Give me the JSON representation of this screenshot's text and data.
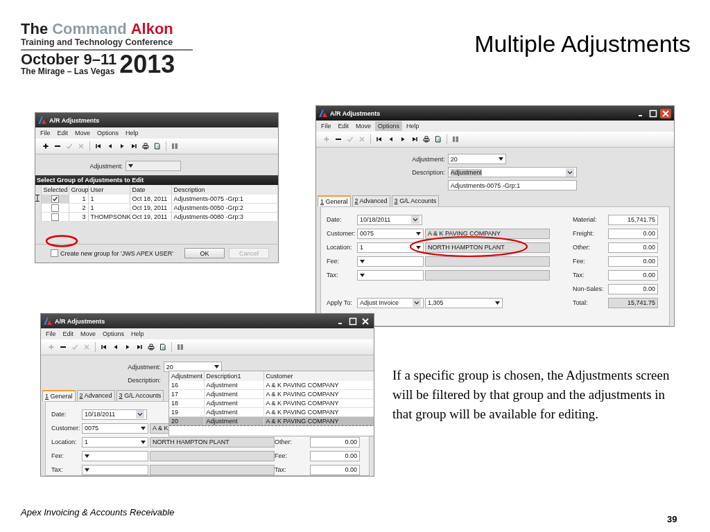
{
  "logo": {
    "words": [
      {
        "text": "The",
        "color": "#231f20"
      },
      {
        "text": "Command",
        "color": "#8d9ca6"
      },
      {
        "text": "Alkon",
        "color": "#c8102e"
      }
    ],
    "tagline": "Training and Technology Conference",
    "dates": "October 9–11",
    "venue": "The Mirage – Las Vegas",
    "year": "2013"
  },
  "title": "Multiple Adjustments",
  "windows": [
    {
      "kind": "group_picker",
      "title": "A/R Adjustments",
      "window_buttons": false,
      "menu": [
        {
          "label": "File",
          "selected": false
        },
        {
          "label": "Edit",
          "selected": false
        },
        {
          "label": "Move",
          "selected": false
        },
        {
          "label": "Options",
          "selected": false
        },
        {
          "label": "Help",
          "selected": false
        }
      ],
      "toolbar": [
        {
          "kind": "add",
          "disabled": false
        },
        {
          "kind": "remove",
          "disabled": false
        },
        {
          "kind": "confirm",
          "disabled": true
        },
        {
          "kind": "cancel",
          "disabled": true
        },
        {
          "kind": "first",
          "disabled": false
        },
        {
          "kind": "previous",
          "disabled": false
        },
        {
          "kind": "next",
          "disabled": false
        },
        {
          "kind": "last",
          "disabled": false
        },
        {
          "kind": "print",
          "disabled": false
        },
        {
          "kind": "preview",
          "disabled": false
        },
        {
          "kind": "columns",
          "disabled": false
        }
      ],
      "adjustment": {
        "label": "Adjustment:"
      },
      "section_title": "Select Group of Adjustments to Edit",
      "table": {
        "columns": [
          "Selected",
          "Group",
          "User",
          "Date",
          "Description"
        ],
        "rows": [
          {
            "current": true,
            "checked": true,
            "group": "1",
            "user": "1",
            "date": "Oct 18, 2011",
            "description": "Adjustments-0075 -Grp:1"
          },
          {
            "current": false,
            "checked": false,
            "group": "2",
            "user": "1",
            "date": "Oct 19, 2011",
            "description": "Adjustments-0050 -Grp:2"
          },
          {
            "current": false,
            "checked": false,
            "group": "3",
            "user": "THOMPSONK",
            "date": "Oct 19, 2011",
            "description": "Adjustments-0080 -Grp:3"
          }
        ]
      },
      "new_group": {
        "label": "Create new group for 'JWS APEX USER'",
        "checked": false
      },
      "buttons": [
        {
          "label": "OK",
          "disabled": false
        },
        {
          "label": "Cancel",
          "disabled": true
        }
      ]
    },
    {
      "kind": "editor",
      "title": "A/R Adjustments",
      "window_buttons": true,
      "active": true,
      "menu": [
        {
          "label": "File",
          "selected": false
        },
        {
          "label": "Edit",
          "selected": false
        },
        {
          "label": "Move",
          "selected": false
        },
        {
          "label": "Options",
          "selected": true
        },
        {
          "label": "Help",
          "selected": false
        }
      ],
      "toolbar": [
        {
          "kind": "add",
          "disabled": true
        },
        {
          "kind": "remove",
          "disabled": false
        },
        {
          "kind": "confirm",
          "disabled": true
        },
        {
          "kind": "cancel",
          "disabled": true
        },
        {
          "kind": "first",
          "disabled": false
        },
        {
          "kind": "previous",
          "disabled": false
        },
        {
          "kind": "next",
          "disabled": false
        },
        {
          "kind": "last",
          "disabled": false
        },
        {
          "kind": "print",
          "disabled": false
        },
        {
          "kind": "preview",
          "disabled": false
        },
        {
          "kind": "columns",
          "disabled": false
        }
      ],
      "adjustment": {
        "label": "Adjustment:",
        "value": "20"
      },
      "description": {
        "label": "Description:",
        "value": "Adjustment",
        "note": "Adjustments-0075 -Grp:1"
      },
      "tabs": [
        {
          "label": "1 General",
          "selected": true
        },
        {
          "label": "2 Advanced",
          "selected": false
        },
        {
          "label": "3 G/L Accounts",
          "selected": false
        }
      ],
      "rows": [
        {
          "left": {
            "kind": "date",
            "label": "Date:",
            "value": "10/18/2011"
          },
          "right": {
            "label": "Material:",
            "value": "15,741.75",
            "readonly": false
          }
        },
        {
          "left": {
            "kind": "lookup",
            "label": "Customer:",
            "value": "0075",
            "name": "A & K PAVING COMPANY"
          },
          "right": {
            "label": "Freight:",
            "value": "0.00",
            "readonly": false
          }
        },
        {
          "left": {
            "kind": "lookup",
            "label": "Location:",
            "value": "1",
            "name": "NORTH HAMPTON PLANT"
          },
          "right": {
            "label": "Other:",
            "value": "0.00",
            "readonly": false
          }
        },
        {
          "left": {
            "kind": "lookup",
            "label": "Fee:"
          },
          "right": {
            "label": "Fee:",
            "value": "0.00",
            "readonly": false
          }
        },
        {
          "left": {
            "kind": "lookup",
            "label": "Tax:"
          },
          "right": {
            "label": "Tax:",
            "value": "0.00",
            "readonly": false
          }
        },
        {
          "right": {
            "label": "Non-Sales:",
            "value": "0.00",
            "readonly": false
          }
        },
        {
          "left": {
            "kind": "apply",
            "label": "Apply To:",
            "value": "Adjust Invoice",
            "reference": "1,305"
          },
          "right": {
            "label": "Total:",
            "value": "15,741.75",
            "readonly": true
          }
        }
      ]
    },
    {
      "kind": "editor",
      "title": "A/R Adjustments",
      "window_buttons": true,
      "active": false,
      "menu": [
        {
          "label": "File",
          "selected": false
        },
        {
          "label": "Edit",
          "selected": false
        },
        {
          "label": "Move",
          "selected": false
        },
        {
          "label": "Options",
          "selected": false
        },
        {
          "label": "Help",
          "selected": false
        }
      ],
      "toolbar": [
        {
          "kind": "add",
          "disabled": true
        },
        {
          "kind": "remove",
          "disabled": false
        },
        {
          "kind": "confirm",
          "disabled": true
        },
        {
          "kind": "cancel",
          "disabled": true
        },
        {
          "kind": "first",
          "disabled": false
        },
        {
          "kind": "previous",
          "disabled": false
        },
        {
          "kind": "next",
          "disabled": false
        },
        {
          "kind": "last",
          "disabled": false
        },
        {
          "kind": "print",
          "disabled": false
        },
        {
          "kind": "preview",
          "disabled": false
        },
        {
          "kind": "columns",
          "disabled": false
        }
      ],
      "adjustment": {
        "label": "Adjustment:",
        "value": "20"
      },
      "description": {
        "label": "Description:"
      },
      "lookup_list": {
        "columns": [
          "Adjustment",
          "Description1",
          "Customer"
        ],
        "rows": [
          {
            "adjustment": "16",
            "description": "Adjustment",
            "customer": "A & K PAVING COMPANY",
            "selected": false
          },
          {
            "adjustment": "17",
            "description": "Adjustment",
            "customer": "A & K PAVING COMPANY",
            "selected": false
          },
          {
            "adjustment": "18",
            "description": "Adjustment",
            "customer": "A & K PAVING COMPANY",
            "selected": false
          },
          {
            "adjustment": "19",
            "description": "Adjustment",
            "customer": "A & K PAVING COMPANY",
            "selected": false
          },
          {
            "adjustment": "20",
            "description": "Adjustment",
            "customer": "A & K PAVING COMPANY",
            "selected": true
          }
        ]
      },
      "tabs": [
        {
          "label": "1 General",
          "selected": true
        },
        {
          "label": "2 Advanced",
          "selected": false
        },
        {
          "label": "3 G/L Accounts",
          "selected": false
        }
      ],
      "rows": [
        {
          "left": {
            "kind": "date",
            "label": "Date:",
            "value": "10/18/2011"
          }
        },
        {
          "left": {
            "kind": "lookup",
            "label": "Customer:",
            "value": "0075",
            "name": "A & K"
          }
        },
        {
          "left": {
            "kind": "lookup",
            "label": "Location:",
            "value": "1",
            "name": "NORTH HAMPTON PLANT"
          },
          "right": {
            "label": "Other:",
            "value": "0.00",
            "readonly": false
          }
        },
        {
          "left": {
            "kind": "lookup",
            "label": "Fee:"
          },
          "right": {
            "label": "Fee:",
            "value": "0.00",
            "readonly": false
          }
        },
        {
          "left": {
            "kind": "lookup",
            "label": "Tax:"
          },
          "right": {
            "label": "Tax:",
            "value": "0.00",
            "readonly": false
          }
        }
      ]
    }
  ],
  "body_text": "If a specific group is chosen, the Adjustments screen will be filtered by that group and the adjustments in that group will be available for editing.",
  "footer": "Apex Invoicing & Accounts Receivable",
  "page_number": "39"
}
